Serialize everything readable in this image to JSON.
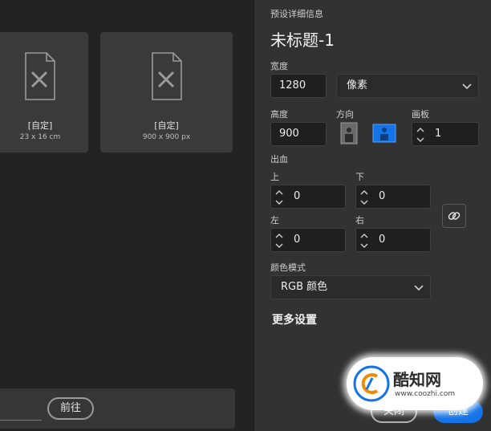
{
  "presets": [
    {
      "title": "[自定]",
      "size": "23 x 16 cm"
    },
    {
      "title": "[自定]",
      "size": "900 x 900 px"
    }
  ],
  "footer_left": {
    "goto_label": "前往"
  },
  "details": {
    "section_title": "预设详细信息",
    "doc_title": "未标题-1",
    "width_label": "宽度",
    "width_value": "1280",
    "unit_value": "像素",
    "height_label": "高度",
    "height_value": "900",
    "orientation_label": "方向",
    "artboard_label": "画板",
    "artboard_value": "1",
    "bleed_label": "出血",
    "top_label": "上",
    "top_value": "0",
    "bottom_label": "下",
    "bottom_value": "0",
    "left_label": "左",
    "left_value": "0",
    "right_label": "右",
    "right_value": "0",
    "color_mode_label": "颜色模式",
    "color_mode_value": "RGB 颜色",
    "more_settings": "更多设置"
  },
  "actions": {
    "close_label": "关闭",
    "create_label": "创建"
  },
  "watermark": {
    "name": "酷知网",
    "url": "www.coozhi.com"
  },
  "colors": {
    "accent": "#1473e6",
    "panel": "#323232",
    "field": "#1f1f1f"
  }
}
